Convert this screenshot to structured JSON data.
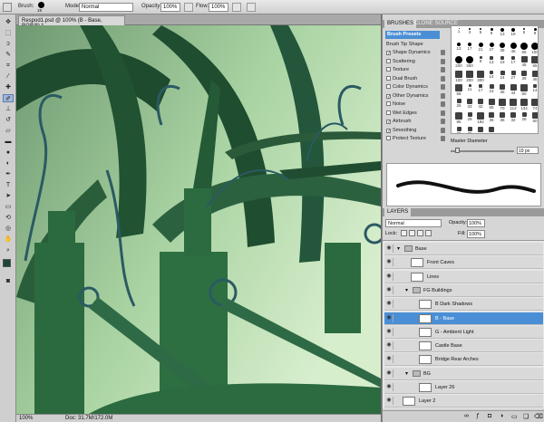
{
  "options_bar": {
    "brush_label": "Brush:",
    "brush_size": "19",
    "mode_label": "Mode:",
    "mode_value": "Normal",
    "opacity_label": "Opacity:",
    "opacity_value": "100%",
    "flow_label": "Flow:",
    "flow_value": "100%"
  },
  "document": {
    "tab_title": "Respod1.psd @ 100% (B - Base, RGB/8) *",
    "zoom": "100%",
    "doc_info": "Doc: 31.7M/172.0M"
  },
  "brushes_panel": {
    "tabs": [
      "BRUSHES",
      "CLONE SOURCE"
    ],
    "presets_button": "Brush Presets",
    "tip_shape": "Brush Tip Shape",
    "options": [
      {
        "label": "Shape Dynamics",
        "checked": true
      },
      {
        "label": "Scattering",
        "checked": false
      },
      {
        "label": "Texture",
        "checked": false
      },
      {
        "label": "Dual Brush",
        "checked": false
      },
      {
        "label": "Color Dynamics",
        "checked": false
      },
      {
        "label": "Other Dynamics",
        "checked": true
      },
      {
        "label": "Noise",
        "checked": false
      },
      {
        "label": "Wet Edges",
        "checked": false
      },
      {
        "label": "Airbrush",
        "checked": true
      },
      {
        "label": "Smoothing",
        "checked": true
      },
      {
        "label": "Protect Texture",
        "checked": false
      }
    ],
    "preset_sizes": [
      "1",
      "3",
      "5",
      "9",
      "13",
      "19",
      "5",
      "9",
      "13",
      "17",
      "21",
      "27",
      "35",
      "45",
      "65",
      "100",
      "200",
      "300",
      "9",
      "13",
      "19",
      "17",
      "45",
      "65",
      "100",
      "200",
      "300",
      "14",
      "24",
      "27",
      "39",
      "46",
      "59",
      "11",
      "17",
      "23",
      "36",
      "44",
      "60",
      "14",
      "26",
      "33",
      "42",
      "55",
      "70",
      "112",
      "134",
      "74",
      "95",
      "29",
      "192",
      "36",
      "36",
      "32",
      "25",
      "50",
      "25",
      "25",
      "41",
      "41"
    ],
    "master_diameter_label": "Master Diameter",
    "master_diameter_value": "19 px"
  },
  "layers_panel": {
    "tab": "LAYERS",
    "blend_mode": "Normal",
    "opacity_label": "Opacity:",
    "opacity_value": "100%",
    "lock_label": "Lock:",
    "fill_label": "Fill:",
    "fill_value": "100%",
    "layers": [
      {
        "name": "Base",
        "type": "group",
        "indent": 0,
        "selected": false
      },
      {
        "name": "Front Caves",
        "type": "layer",
        "indent": 1,
        "selected": false
      },
      {
        "name": "Lines",
        "type": "layer",
        "indent": 1,
        "selected": false
      },
      {
        "name": "FG Buildings",
        "type": "group",
        "indent": 1,
        "selected": false
      },
      {
        "name": "B Dark Shadows",
        "type": "layer",
        "indent": 2,
        "selected": false
      },
      {
        "name": "B - Base",
        "type": "layer",
        "indent": 2,
        "selected": true
      },
      {
        "name": "G - Ambient Light",
        "type": "layer",
        "indent": 2,
        "selected": false
      },
      {
        "name": "Castle Base",
        "type": "layer",
        "indent": 2,
        "selected": false
      },
      {
        "name": "Bridge Rear Arches",
        "type": "layer",
        "indent": 2,
        "selected": false
      },
      {
        "name": "BG",
        "type": "group",
        "indent": 1,
        "selected": false
      },
      {
        "name": "Layer 26",
        "type": "layer",
        "indent": 2,
        "selected": false
      },
      {
        "name": "Layer 2",
        "type": "layer",
        "indent": 0,
        "selected": false
      }
    ]
  },
  "colors": {
    "selection": "#4a8fd6",
    "canvas_dark": "#1f4a2d",
    "canvas_light": "#cfe8c8",
    "ink": "#2a5a62"
  }
}
